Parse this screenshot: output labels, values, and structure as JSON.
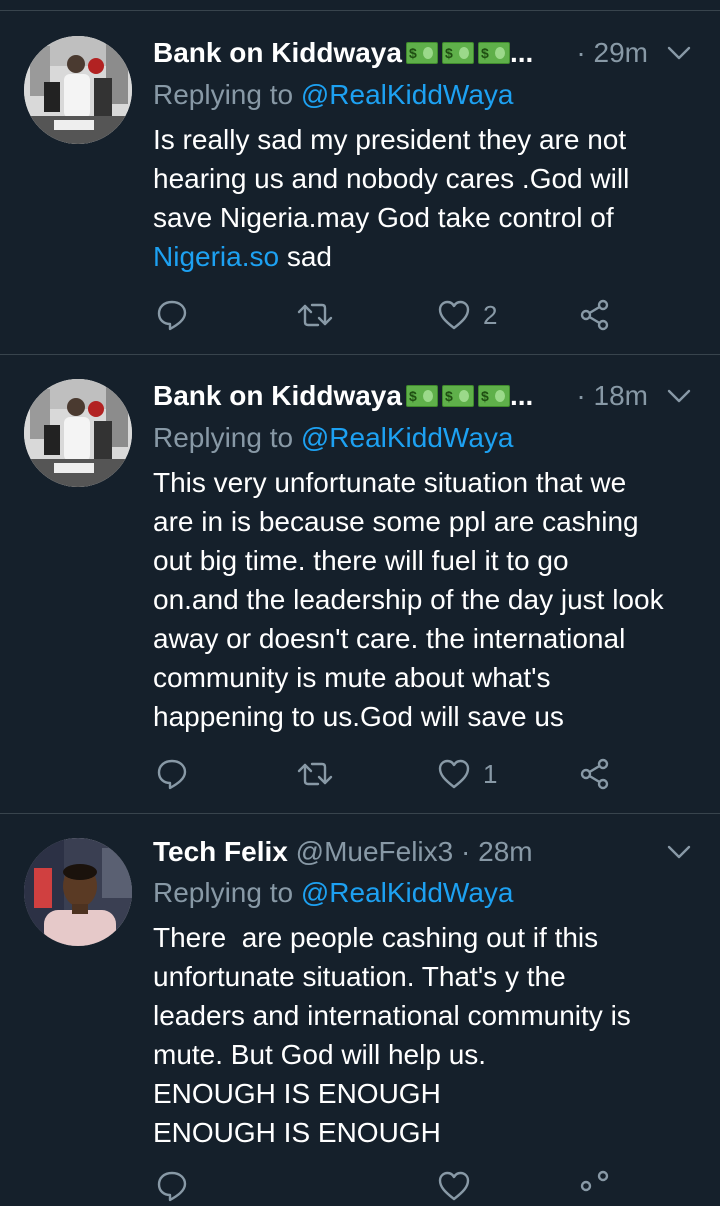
{
  "tweets": [
    {
      "name": "Bank on Kiddwaya",
      "money_emoji": "money-with-wings",
      "ellipsis": "...",
      "handle": "",
      "time": "· 29m",
      "reply_prefix": "Replying to ",
      "reply_to": "@RealKiddWaya",
      "text": "Is really sad my president they are not\nhearing us and nobody cares .God will\nsave Nigeria.may God take control of\n",
      "link_text": "Nigeria.so",
      "text_after_link": " sad",
      "likes": "2"
    },
    {
      "name": "Bank on Kiddwaya",
      "money_emoji": "money-with-wings",
      "ellipsis": "...",
      "handle": "",
      "time": "· 18m",
      "reply_prefix": "Replying to ",
      "reply_to": "@RealKiddWaya",
      "text": "This very unfortunate situation that we\nare in is because some ppl are cashing\nout big time. there will fuel it to go\non.and the leadership of the day just look\naway or doesn't care. the international\ncommunity is mute about what's\nhappening to us.God will save us",
      "likes": "1"
    },
    {
      "name": "Tech Felix",
      "handle": "@MueFelix3",
      "time": "· 28m",
      "reply_prefix": "Replying to ",
      "reply_to": "@RealKiddWaya",
      "text": "There  are people cashing out if this\nunfortunate situation. That's y the\nleaders and international community is\nmute. But God will help us.\nENOUGH IS ENOUGH\nENOUGH IS ENOUGH"
    }
  ],
  "colors": {
    "background": "#15202b",
    "divider": "#38444d",
    "secondary_text": "#8899a6",
    "link": "#1da1f2"
  }
}
